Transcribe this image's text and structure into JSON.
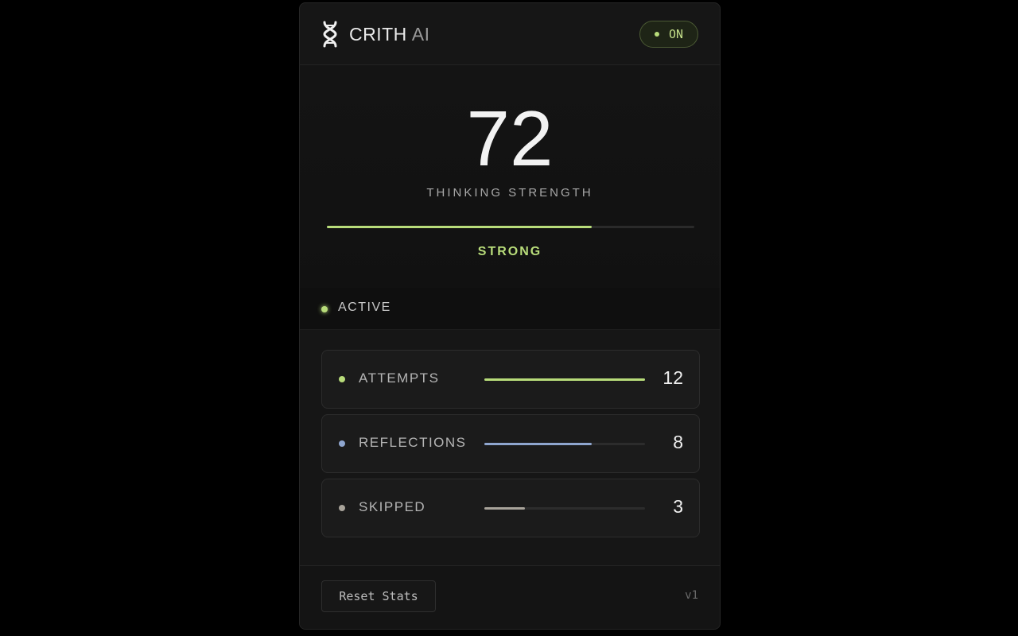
{
  "header": {
    "brand_name": "CRITH",
    "brand_suffix": "AI",
    "logo_icon": "dna-icon",
    "toggle_label": "ON"
  },
  "score": {
    "value": "72",
    "label": "THINKING STRENGTH",
    "progress": 0.72,
    "level": "STRONG"
  },
  "status": {
    "label": "ACTIVE"
  },
  "stats": [
    {
      "label": "ATTEMPTS",
      "value": "12",
      "fraction": 1.0,
      "color": "#b8dc7a"
    },
    {
      "label": "REFLECTIONS",
      "value": "8",
      "fraction": 0.667,
      "color": "#8fa6cf"
    },
    {
      "label": "SKIPPED",
      "value": "3",
      "fraction": 0.25,
      "color": "#a8a39a"
    }
  ],
  "footer": {
    "reset_label": "Reset Stats",
    "version": "v1"
  },
  "colors": {
    "accent": "#b8dc7a",
    "background": "#161616"
  }
}
